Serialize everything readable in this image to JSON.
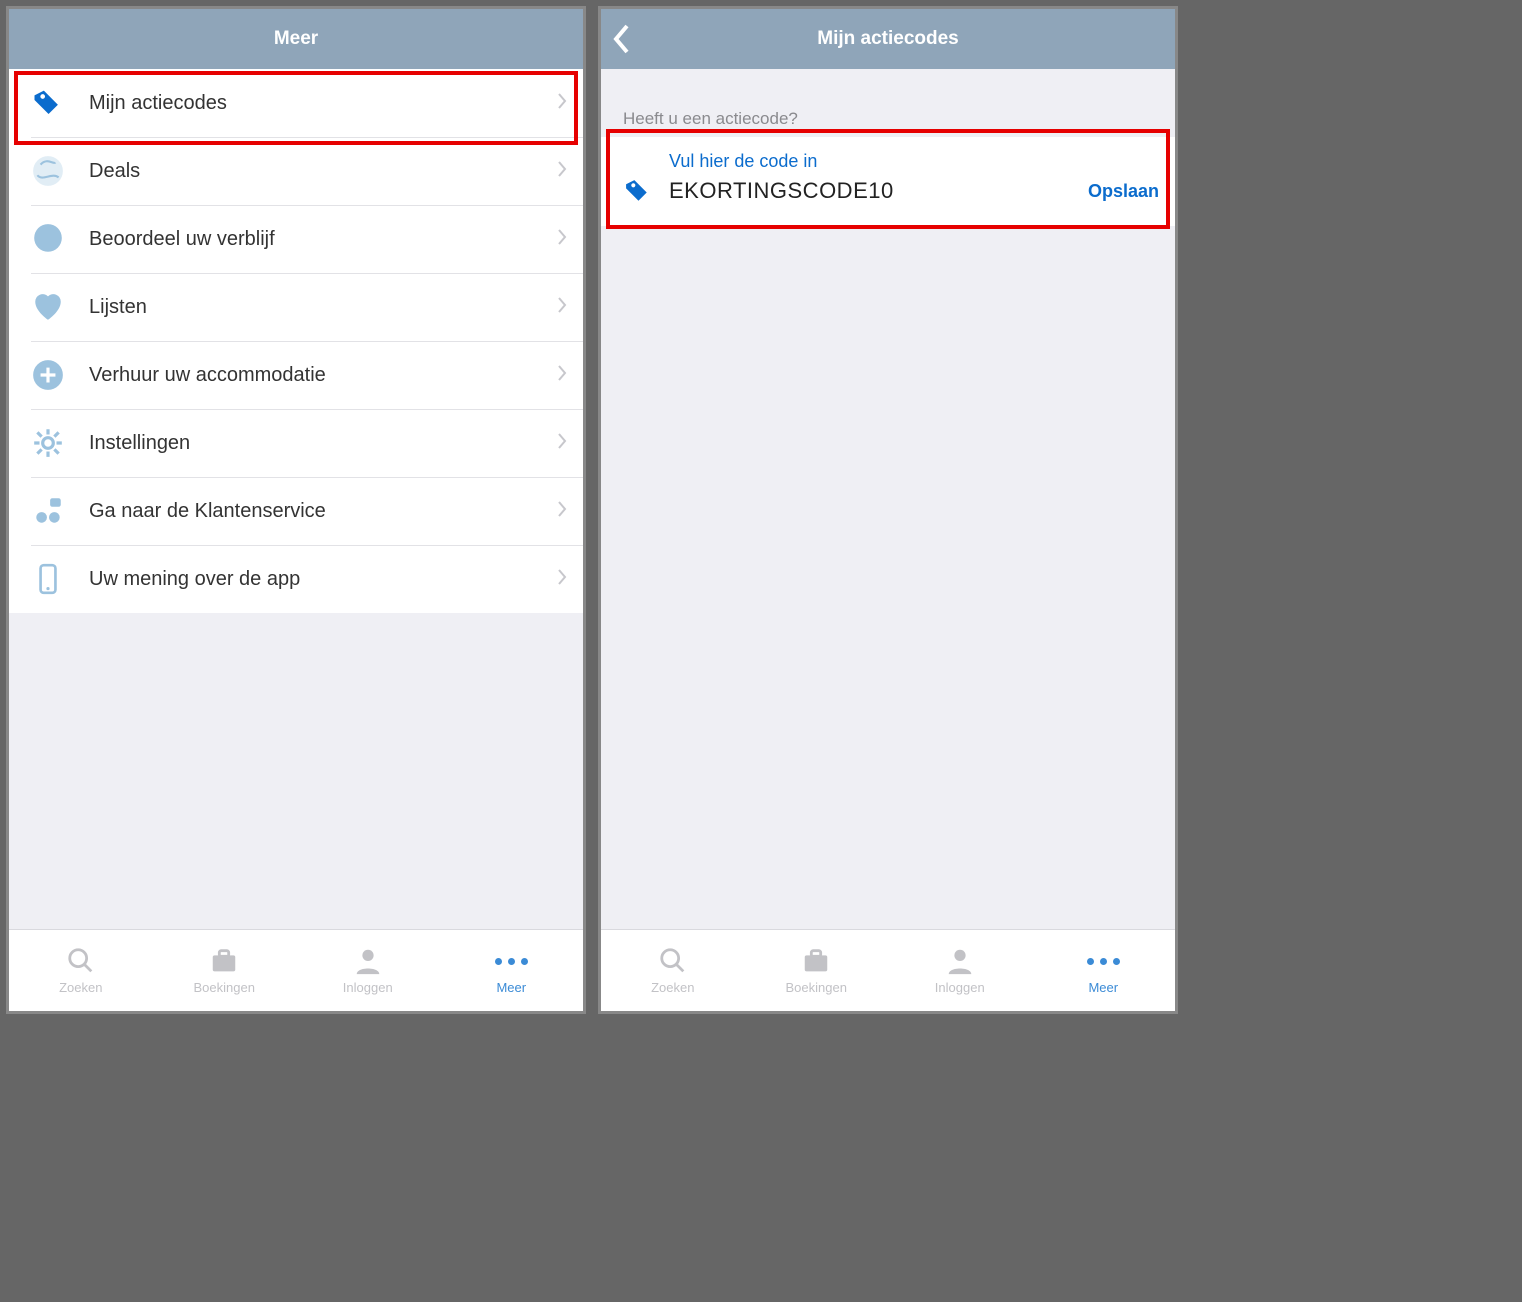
{
  "colors": {
    "navbar": "#8fa5b9",
    "accent": "#0b6ccd",
    "iconDefault": "#9cc2de",
    "highlight": "#e60000"
  },
  "left": {
    "title": "Meer",
    "menu": [
      {
        "icon": "tag-icon",
        "label": "Mijn actiecodes",
        "highlighted": true
      },
      {
        "icon": "globe-icon",
        "label": "Deals"
      },
      {
        "icon": "chat-icon",
        "label": "Beoordeel uw verblijf"
      },
      {
        "icon": "heart-icon",
        "label": "Lijsten"
      },
      {
        "icon": "plus-circle-icon",
        "label": "Verhuur uw accommodatie"
      },
      {
        "icon": "gear-icon",
        "label": "Instellingen"
      },
      {
        "icon": "support-icon",
        "label": "Ga naar de Klantenservice"
      },
      {
        "icon": "phone-icon",
        "label": "Uw mening over de app"
      }
    ]
  },
  "right": {
    "title": "Mijn actiecodes",
    "sectionHeader": "Heeft u een actiecode?",
    "hint": "Vul hier de code in",
    "codeValue": "EKORTINGSCODE10",
    "saveLabel": "Opslaan"
  },
  "tabbar": [
    {
      "icon": "search-icon",
      "label": "Zoeken"
    },
    {
      "icon": "suitcase-icon",
      "label": "Boekingen"
    },
    {
      "icon": "user-icon",
      "label": "Inloggen"
    },
    {
      "icon": "dots-icon",
      "label": "Meer",
      "active": true
    }
  ]
}
